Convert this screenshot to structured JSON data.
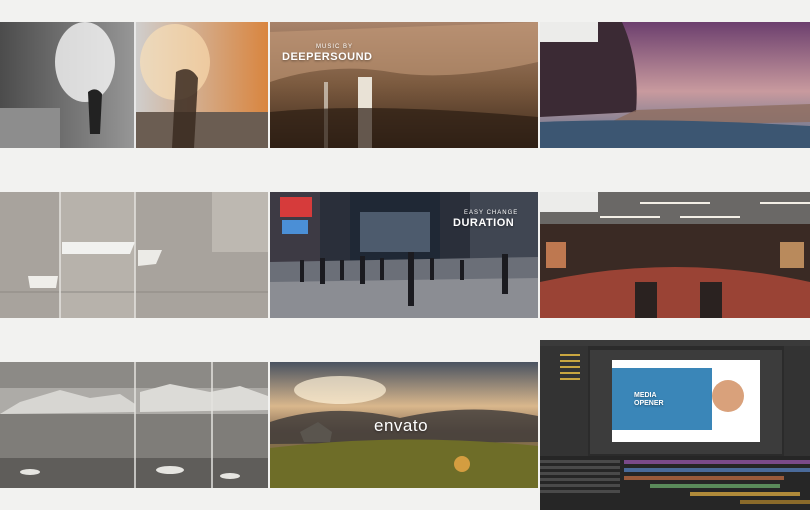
{
  "tiles": [
    {
      "name": "splash-photo-tile"
    },
    {
      "name": "waterfall-tile",
      "overlay_small": "MUSIC BY",
      "overlay_big": "DEEPERSOUND"
    },
    {
      "name": "cliff-coast-tile"
    },
    {
      "name": "boats-sea-tile"
    },
    {
      "name": "city-street-tile",
      "overlay_small": "EASY CHANGE",
      "overlay_big": "DURATION"
    },
    {
      "name": "subway-station-tile"
    },
    {
      "name": "icebergs-tile"
    },
    {
      "name": "landscape-logo-tile",
      "logo_text": "envato"
    },
    {
      "name": "editor-screenshot-tile",
      "preview_title_1": "MEDIA",
      "preview_title_2": "OPENER"
    }
  ]
}
